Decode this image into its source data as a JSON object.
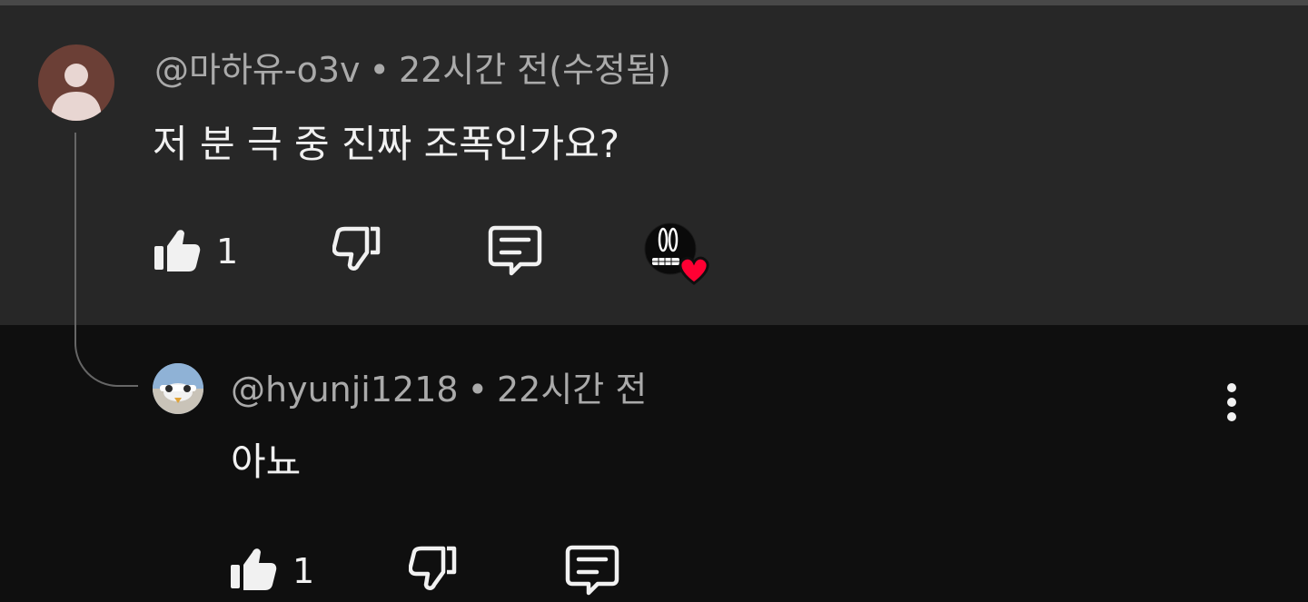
{
  "parent_comment": {
    "author": "@마하유-o3v",
    "separator": "•",
    "time": "22시간 전(수정됨)",
    "text": "저 분 극 중 진짜 조폭인가요?",
    "like_count": "1",
    "icons": {
      "like": "thumb-up-icon",
      "dislike": "thumb-down-icon",
      "reply": "comment-icon",
      "creator_heart": "creator-heart-badge"
    },
    "colors": {
      "background": "#272727",
      "heart": "#ff0033"
    }
  },
  "reply_comment": {
    "author": "@hyunji1218",
    "separator": "•",
    "time": "22시간 전",
    "text": "아뇨",
    "like_count": "1",
    "icons": {
      "like": "thumb-up-icon",
      "dislike": "thumb-down-icon",
      "reply": "comment-icon",
      "more": "more-vert-icon"
    },
    "colors": {
      "background": "#0f0f0f"
    }
  }
}
